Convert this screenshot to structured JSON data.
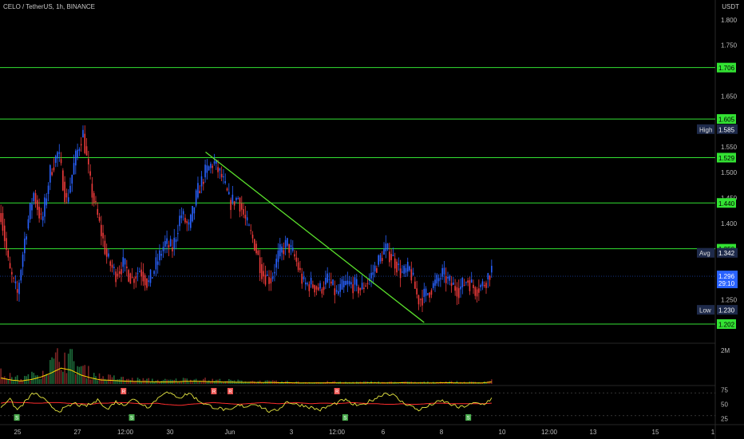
{
  "header": {
    "title": "CELO / TetherUS, 1h, BINANCE",
    "currency": "USDT"
  },
  "colors": {
    "up": "#2962ff",
    "down": "#ef3b3b",
    "level": "#33e233",
    "trend": "#5ae02c",
    "ma": "#ffd600",
    "rsi": "#e8e840",
    "rsi_ma": "#ff2d2d",
    "bg": "#000000"
  },
  "chart_data": [
    {
      "type": "candlestick",
      "title": "CELO / TetherUS, 1h, BINANCE",
      "y_axis": {
        "ticks": [
          "1.800",
          "1.750",
          "1.650",
          "1.550",
          "1.500",
          "1.450",
          "1.400",
          "1.250"
        ],
        "ylim": [
          1.18,
          1.82
        ]
      },
      "x_axis": {
        "ticks": [
          "25",
          "27",
          "12:00",
          "30",
          "Jun",
          "3",
          "12:00",
          "6",
          "8",
          "10",
          "12:00",
          "13",
          "15",
          "1"
        ]
      },
      "price_path": [
        1.42,
        1.31,
        1.26,
        1.38,
        1.46,
        1.4,
        1.5,
        1.54,
        1.44,
        1.52,
        1.58,
        1.47,
        1.4,
        1.33,
        1.3,
        1.32,
        1.29,
        1.31,
        1.28,
        1.32,
        1.36,
        1.35,
        1.42,
        1.39,
        1.46,
        1.5,
        1.52,
        1.49,
        1.44,
        1.45,
        1.4,
        1.36,
        1.3,
        1.29,
        1.34,
        1.36,
        1.33,
        1.28,
        1.28,
        1.27,
        1.29,
        1.26,
        1.28,
        1.28,
        1.27,
        1.29,
        1.32,
        1.35,
        1.33,
        1.3,
        1.31,
        1.25,
        1.26,
        1.28,
        1.3,
        1.28,
        1.27,
        1.29,
        1.27,
        1.28,
        1.31
      ],
      "levels": [
        {
          "value": 1.706,
          "label": "1.706"
        },
        {
          "value": 1.605,
          "label": "1.605"
        },
        {
          "value": 1.529,
          "label": "1.529"
        },
        {
          "value": 1.44,
          "label": "1.440"
        },
        {
          "value": 1.35,
          "label": "1.350"
        },
        {
          "value": 1.202,
          "label": "1.202"
        }
      ],
      "trendline": {
        "from": [
          26.5,
          1.54
        ],
        "to": [
          40.0,
          1.205
        ]
      },
      "markers": [
        {
          "tag": "High",
          "label": "1.585",
          "value": 1.585
        },
        {
          "tag": "Avg",
          "label": "1.342",
          "value": 1.342
        },
        {
          "tag": "Low",
          "label": "1.230",
          "value": 1.23
        }
      ],
      "last": {
        "price": "1.296",
        "countdown": "29:10",
        "value": 1.296
      }
    },
    {
      "type": "bar",
      "title": "Volume",
      "y_axis": {
        "ticks": [
          "2M"
        ]
      },
      "volume_profile": [
        0.3,
        0.2,
        0.15,
        0.22,
        0.35,
        0.55,
        0.8,
        0.7,
        0.45,
        0.3,
        0.2,
        0.18,
        0.15,
        0.13,
        0.12,
        0.11,
        0.1,
        0.1,
        0.12,
        0.14,
        0.13,
        0.11,
        0.1,
        0.09,
        0.08,
        0.08,
        0.07,
        0.07,
        0.06,
        0.06,
        0.05,
        0.05,
        0.05,
        0.06,
        0.05,
        0.05,
        0.05,
        0.06,
        0.05,
        0.05,
        0.06,
        0.05,
        0.05,
        0.05,
        0.06,
        0.06,
        0.05,
        0.05,
        0.05,
        0.1
      ]
    },
    {
      "type": "line",
      "title": "RSI",
      "y_axis": {
        "ticks": [
          "75",
          "50",
          "25"
        ],
        "ylim": [
          20,
          80
        ]
      },
      "rsi_path": [
        45,
        60,
        40,
        55,
        70,
        62,
        48,
        38,
        44,
        52,
        46,
        50,
        58,
        40,
        55,
        48,
        60,
        52,
        45,
        58,
        72,
        66,
        62,
        70,
        58,
        50,
        45,
        42,
        38,
        48,
        46,
        52,
        44,
        36,
        42,
        55,
        50,
        48,
        44,
        40,
        46,
        52,
        58,
        50,
        47,
        55,
        62,
        70,
        66,
        54,
        48,
        40,
        45,
        52,
        56,
        50,
        44,
        48,
        52,
        50,
        60
      ],
      "rsi_ma_path": [
        52,
        54,
        53,
        53,
        52,
        52,
        53,
        53,
        52,
        51,
        51,
        50,
        52,
        52,
        53,
        53,
        52,
        51,
        51,
        52,
        50,
        49,
        48,
        50,
        51,
        52,
        53,
        52,
        51,
        50,
        51,
        52,
        53,
        52,
        51,
        52,
        53,
        52,
        51,
        52,
        52,
        51,
        52,
        53,
        52,
        51,
        51,
        50,
        50,
        51,
        50,
        50,
        51,
        52,
        52,
        51,
        51,
        51,
        51,
        51,
        52
      ],
      "signals": [
        {
          "tag": "R",
          "at": 15,
          "kind": "top"
        },
        {
          "tag": "R",
          "at": 26,
          "kind": "top"
        },
        {
          "tag": "R",
          "at": 28,
          "kind": "top"
        },
        {
          "tag": "R",
          "at": 41,
          "kind": "top"
        },
        {
          "tag": "S",
          "at": 2,
          "kind": "bot"
        },
        {
          "tag": "S",
          "at": 16,
          "kind": "bot"
        },
        {
          "tag": "S",
          "at": 42,
          "kind": "bot"
        },
        {
          "tag": "S",
          "at": 57,
          "kind": "bot"
        }
      ]
    }
  ]
}
